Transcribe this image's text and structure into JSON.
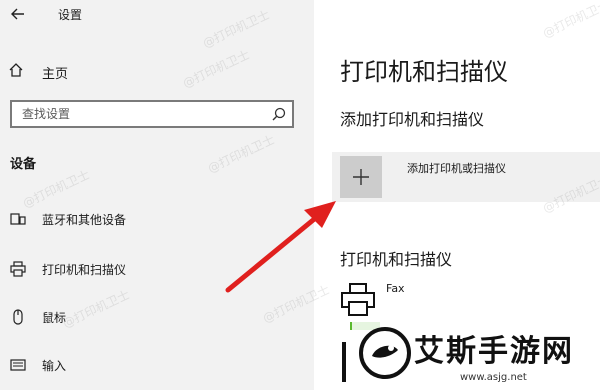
{
  "window": {
    "title": "设置"
  },
  "sidebar": {
    "home_label": "主页",
    "search_placeholder": "查找设置",
    "section_header": "设备",
    "items": [
      {
        "label": "蓝牙和其他设备",
        "icon": "bluetooth-devices-icon"
      },
      {
        "label": "打印机和扫描仪",
        "icon": "printer-icon"
      },
      {
        "label": "鼠标",
        "icon": "mouse-icon"
      },
      {
        "label": "输入",
        "icon": "keyboard-icon"
      }
    ]
  },
  "main": {
    "title": "打印机和扫描仪",
    "add_section_title": "添加打印机和扫描仪",
    "add_button_label": "添加打印机或扫描仪",
    "list_section_title": "打印机和扫描仪",
    "printers": [
      {
        "name": "Fax",
        "icon": "printer-icon"
      }
    ]
  },
  "watermark": {
    "text": "@打印机卫士"
  },
  "overlay_badge": {
    "name": "艾斯手游网",
    "url": "www.asjg.net"
  },
  "colors": {
    "sidebar_bg": "#f2f2f2",
    "accent_arrow": "#e0201e",
    "tile_bg": "#f0f0f0"
  }
}
